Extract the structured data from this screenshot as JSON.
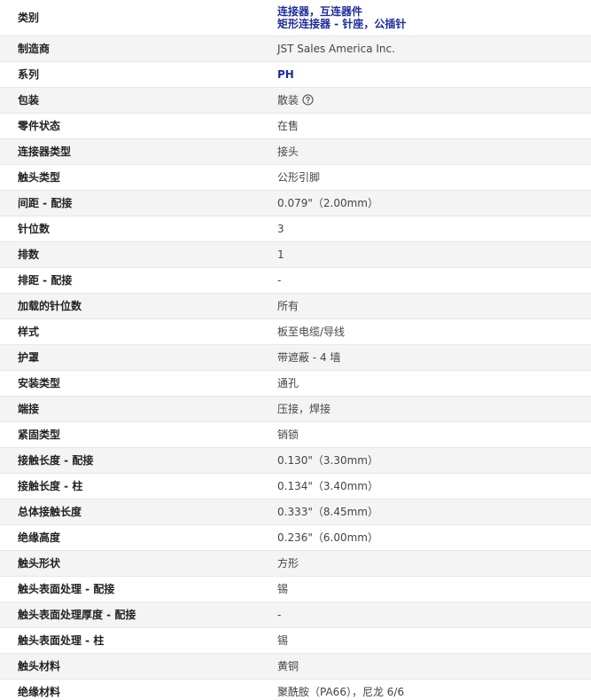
{
  "specs": {
    "rows": [
      {
        "label": "类别",
        "links": [
          "连接器，互连器件",
          "矩形连接器 - 针座，公插针"
        ]
      },
      {
        "label": "制造商",
        "value": "JST Sales America Inc."
      },
      {
        "label": "系列",
        "link": "PH"
      },
      {
        "label": "包装",
        "value": "散装",
        "help_icon": "question-circle-icon"
      },
      {
        "label": "零件状态",
        "value": "在售"
      },
      {
        "label": "连接器类型",
        "value": "接头"
      },
      {
        "label": "触头类型",
        "value": "公形引脚"
      },
      {
        "label": "间距 - 配接",
        "value": "0.079\"（2.00mm）"
      },
      {
        "label": "针位数",
        "value": "3"
      },
      {
        "label": "排数",
        "value": "1"
      },
      {
        "label": "排距 - 配接",
        "value": "-"
      },
      {
        "label": "加载的针位数",
        "value": "所有"
      },
      {
        "label": "样式",
        "value": "板至电缆/导线"
      },
      {
        "label": "护罩",
        "value": "带遮蔽 - 4 墙"
      },
      {
        "label": "安装类型",
        "value": "通孔"
      },
      {
        "label": "端接",
        "value": "压接，焊接"
      },
      {
        "label": "紧固类型",
        "value": "销锁"
      },
      {
        "label": "接触长度 - 配接",
        "value": "0.130\"（3.30mm）"
      },
      {
        "label": "接触长度 - 柱",
        "value": "0.134\"（3.40mm）"
      },
      {
        "label": "总体接触长度",
        "value": "0.333\"（8.45mm）"
      },
      {
        "label": "绝缘高度",
        "value": "0.236\"（6.00mm）"
      },
      {
        "label": "触头形状",
        "value": "方形"
      },
      {
        "label": "触头表面处理 - 配接",
        "value": "锡"
      },
      {
        "label": "触头表面处理厚度 - 配接",
        "value": "-"
      },
      {
        "label": "触头表面处理 - 柱",
        "value": "锡"
      },
      {
        "label": "触头材料",
        "value": "黄铜"
      },
      {
        "label": "绝缘材料",
        "value": "聚酰胺（PA66），尼龙 6/6"
      }
    ]
  },
  "colors": {
    "link": "#1f2d9c",
    "zebra": "#f4f4f4",
    "border": "#e6e6e6"
  }
}
